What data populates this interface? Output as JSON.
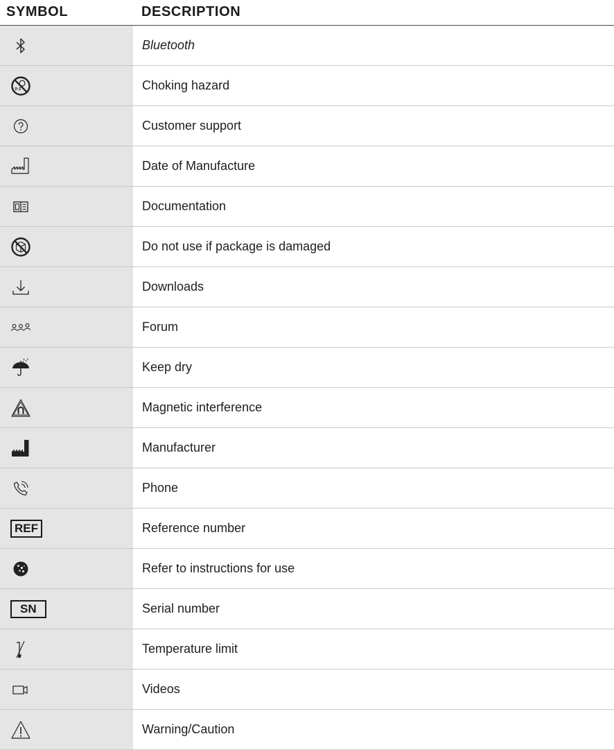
{
  "header": {
    "symbol_label": "SYMBOL",
    "description_label": "DESCRIPTION"
  },
  "rows": [
    {
      "icon": "bluetooth-icon",
      "description": "Bluetooth"
    },
    {
      "icon": "choking-hazard-icon",
      "description": "Choking hazard",
      "icon_text": "0-3"
    },
    {
      "icon": "customer-support-icon",
      "description": "Customer support"
    },
    {
      "icon": "date-of-manufacture-icon",
      "description": "Date of Manufacture"
    },
    {
      "icon": "documentation-icon",
      "description": "Documentation"
    },
    {
      "icon": "do-not-use-if-damaged-icon",
      "description": "Do not use if package is damaged"
    },
    {
      "icon": "downloads-icon",
      "description": "Downloads"
    },
    {
      "icon": "forum-icon",
      "description": "Forum"
    },
    {
      "icon": "keep-dry-icon",
      "description": "Keep dry"
    },
    {
      "icon": "magnetic-interference-icon",
      "description": "Magnetic interference"
    },
    {
      "icon": "manufacturer-icon",
      "description": "Manufacturer"
    },
    {
      "icon": "phone-icon",
      "description": "Phone"
    },
    {
      "icon": "reference-number-icon",
      "description": "Reference number",
      "icon_text": "REF"
    },
    {
      "icon": "refer-to-instructions-icon",
      "description": "Refer to instructions for use"
    },
    {
      "icon": "serial-number-icon",
      "description": "Serial number",
      "icon_text": "SN"
    },
    {
      "icon": "temperature-limit-icon",
      "description": "Temperature limit"
    },
    {
      "icon": "videos-icon",
      "description": "Videos"
    },
    {
      "icon": "warning-caution-icon",
      "description": "Warning/Caution"
    }
  ]
}
